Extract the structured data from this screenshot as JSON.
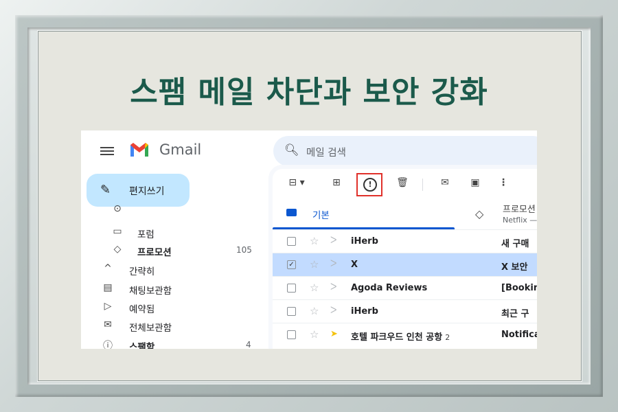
{
  "headline": "스팸 메일 차단과 보안 강화",
  "app": {
    "name": "Gmail"
  },
  "compose": {
    "label": "편지쓰기"
  },
  "search": {
    "placeholder": "메일 검색"
  },
  "sidebar": {
    "items": [
      {
        "icon": "label-icon",
        "label": "",
        "count": ""
      },
      {
        "icon": "forum-icon",
        "label": "포럼",
        "count": ""
      },
      {
        "icon": "tag-icon",
        "label": "프로모션",
        "count": "105",
        "bold": true
      },
      {
        "icon": "chevron-up-icon",
        "label": "간략히",
        "count": ""
      },
      {
        "icon": "chat-icon",
        "label": "채팅보관함",
        "count": ""
      },
      {
        "icon": "scheduled-icon",
        "label": "예약됨",
        "count": ""
      },
      {
        "icon": "all-mail-icon",
        "label": "전체보관함",
        "count": ""
      },
      {
        "icon": "spam-icon",
        "label": "스팸함",
        "count": "4",
        "bold": true
      }
    ]
  },
  "toolbar": {
    "buttons": [
      "select-checkbox",
      "archive",
      "report-spam",
      "delete",
      "mark-read",
      "move-to",
      "more"
    ],
    "highlighted": "report-spam",
    "highlight_color": "#e0302a"
  },
  "tabs": {
    "basic": {
      "label": "기본",
      "active": true
    },
    "promo": {
      "label": "프로모션",
      "sub": "Netflix —"
    }
  },
  "emails": [
    {
      "sender": "iHerb",
      "count": "",
      "subject": "새 구매",
      "selected": false,
      "checked": false,
      "important": false
    },
    {
      "sender": "X",
      "count": "",
      "subject": "X 보안",
      "selected": true,
      "checked": true,
      "important": false
    },
    {
      "sender": "Agoda Reviews",
      "count": "",
      "subject": "[Bookin",
      "selected": false,
      "checked": false,
      "important": false
    },
    {
      "sender": "iHerb",
      "count": "",
      "subject": "최근 구",
      "selected": false,
      "checked": false,
      "important": false
    },
    {
      "sender": "호텔 파크우드 인천 공항",
      "count": "2",
      "subject": "Notifica",
      "selected": false,
      "checked": false,
      "important": true
    }
  ],
  "colors": {
    "headline": "#1b5a4b",
    "accent": "#0b57d0",
    "compose_bg": "#c2e7ff",
    "selected_row": "#c2dbff"
  }
}
